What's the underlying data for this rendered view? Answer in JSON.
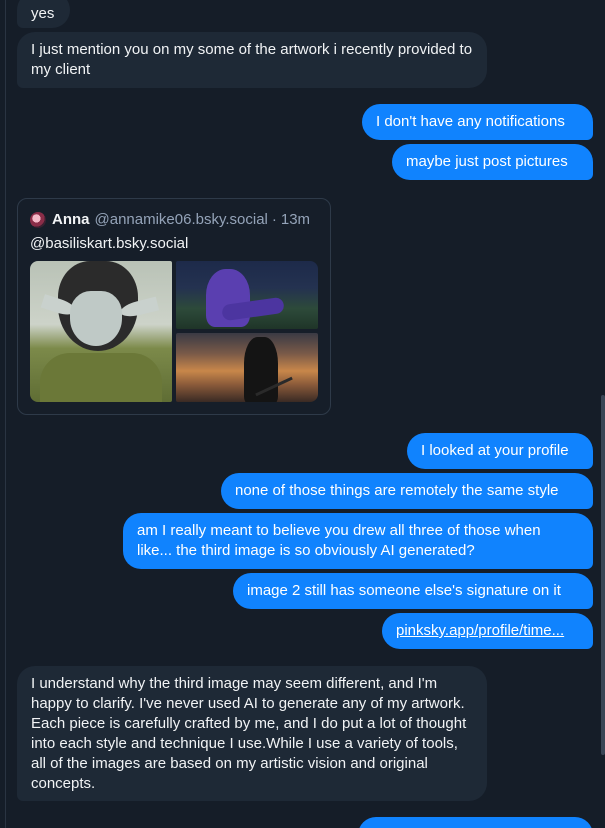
{
  "messages": [
    {
      "side": "in",
      "text": "yes"
    },
    {
      "side": "in",
      "text": "I just mention you on my some of the artwork i recently provided to my client"
    },
    {
      "side": "out",
      "text": "I don't have any notifications"
    },
    {
      "side": "out",
      "text": "maybe just post pictures"
    },
    {
      "side": "out",
      "text": "I looked at your profile"
    },
    {
      "side": "out",
      "text": "none of those things are remotely the same style"
    },
    {
      "side": "out",
      "text": "am I really meant to believe you drew all three of those when like... the third image is so obviously AI generated?"
    },
    {
      "side": "out",
      "text": "image 2 still has someone else's signature on it"
    },
    {
      "side": "out",
      "text": "pinksky.app/profile/time..."
    },
    {
      "side": "in",
      "text": "I understand why the third image may seem different, and I'm happy to clarify. I've never used AI to generate any of my artwork. Each piece is carefully crafted by me, and I do put a lot of thought into each style and technique I use.While I use a variety of tools, all of the images are based on my artistic vision and original concepts."
    }
  ],
  "embed": {
    "author_name": "Anna",
    "author_handle": "@annamike06.bsky.social",
    "separator": "·",
    "time": "13m",
    "text": "@basiliskart.bsky.social",
    "avatar_icon": "avatar-icon"
  },
  "colors": {
    "background": "#151d28",
    "incoming_bubble": "#1e2936",
    "outgoing_bubble": "#1083fe",
    "muted_text": "#94a3b8"
  }
}
